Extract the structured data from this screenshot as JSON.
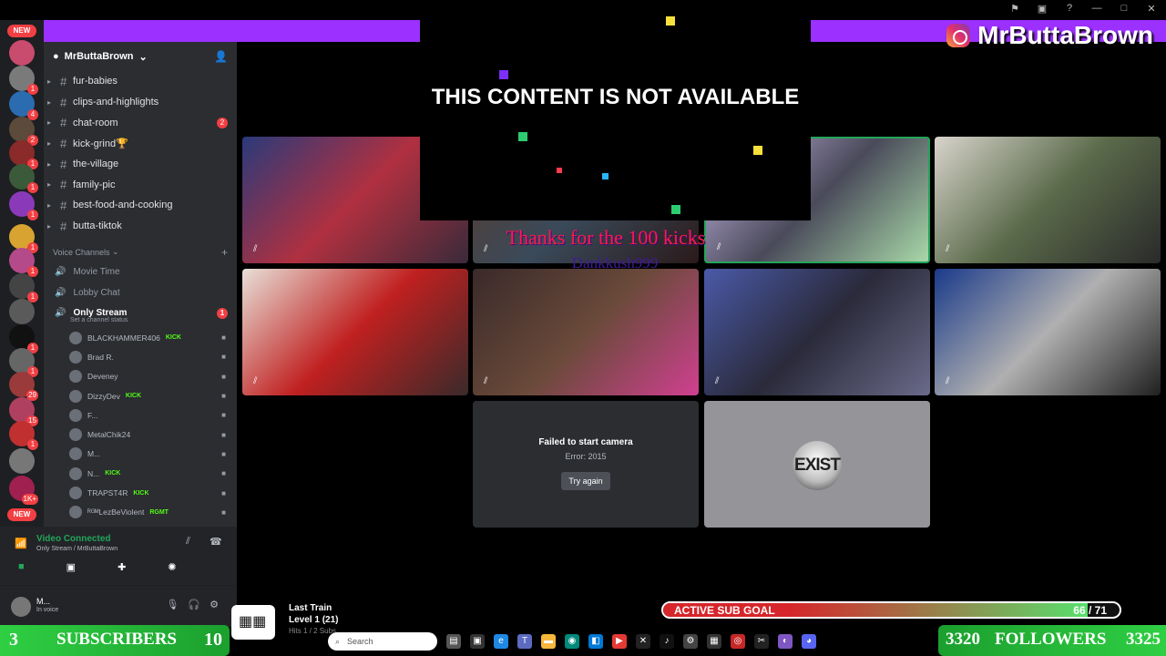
{
  "brand": {
    "name": "MrButtaBrown"
  },
  "window_controls": [
    "⚑",
    "▣",
    "?",
    "—",
    "□",
    "✕"
  ],
  "servers": [
    {
      "top": 0,
      "color": "#c94b6e",
      "badge": ""
    },
    {
      "top": 0,
      "color": "#7a7a7a",
      "badge": "1"
    },
    {
      "top": 0,
      "color": "#2b6cb0",
      "badge": "4"
    },
    {
      "top": 0,
      "color": "#5c4a3a",
      "badge": "2"
    },
    {
      "top": 0,
      "color": "#8b2a2a",
      "badge": "1"
    },
    {
      "top": 0,
      "color": "#3a5a3a",
      "badge": "1"
    },
    {
      "top": 0,
      "color": "#8a3ab9",
      "badge": "1"
    },
    {
      "top": 0,
      "color": "#d9a331",
      "badge": "1"
    },
    {
      "top": 0,
      "color": "#b54a8a",
      "badge": "1"
    },
    {
      "top": 0,
      "color": "#444",
      "badge": "1"
    },
    {
      "top": 0,
      "color": "#5a5a5a",
      "badge": ""
    },
    {
      "top": 0,
      "color": "#111",
      "badge": "1"
    },
    {
      "top": 0,
      "color": "#666",
      "badge": "1"
    },
    {
      "top": 0,
      "color": "#9a3a3a",
      "badge": "29"
    },
    {
      "top": 0,
      "color": "#b04060",
      "badge": "15"
    },
    {
      "top": 0,
      "color": "#c03030",
      "badge": "1"
    },
    {
      "top": 0,
      "color": "#777",
      "badge": ""
    },
    {
      "top": 0,
      "color": "#a02050",
      "badge": "1K+"
    }
  ],
  "new_labels": [
    "NEW",
    "NEW"
  ],
  "guild": {
    "name": "MrButtaBrown"
  },
  "text_channels": [
    {
      "name": "fur-babies",
      "badge": ""
    },
    {
      "name": "clips-and-highlights",
      "badge": ""
    },
    {
      "name": "chat-room",
      "badge": "2"
    },
    {
      "name": "kick-grind🏆",
      "badge": ""
    },
    {
      "name": "the-village",
      "badge": ""
    },
    {
      "name": "family-pic",
      "badge": ""
    },
    {
      "name": "best-food-and-cooking",
      "badge": ""
    },
    {
      "name": "butta-tiktok",
      "badge": ""
    }
  ],
  "voice_section": "Voice Channels",
  "voice_channels": [
    {
      "name": "Movie Time",
      "badge": ""
    },
    {
      "name": "Lobby Chat",
      "badge": ""
    },
    {
      "name": "Only Stream",
      "badge": "1"
    }
  ],
  "channel_status": "Set a channel status",
  "voice_users": [
    {
      "name": "BLACKHAMMER406",
      "kick": "KICK"
    },
    {
      "name": "Brad R.",
      "kick": ""
    },
    {
      "name": "Deveney",
      "kick": ""
    },
    {
      "name": "DizzyDev",
      "kick": "KICK"
    },
    {
      "name": "F...",
      "kick": ""
    },
    {
      "name": "MetalChik24",
      "kick": ""
    },
    {
      "name": "M...",
      "kick": ""
    },
    {
      "name": "N...",
      "kick": "KICK"
    },
    {
      "name": "TRAPST4R",
      "kick": "KICK"
    },
    {
      "name": "ᴿᴳᴹLezBeViolent",
      "kick": "RGMT"
    }
  ],
  "voice_status": {
    "title": "Video Connected",
    "sub": "Only Stream / MrButtaBrown"
  },
  "user_panel": {
    "name": "M...",
    "status": "In voice"
  },
  "stage": {
    "unavailable": "THIS CONTENT IS NOT AVAILABLE",
    "kicks_msg": "Thanks for the 100 kicks",
    "kicks_user": "Dankkush999",
    "cam_error_title": "Failed to start camera",
    "cam_error_code": "Error: 2015",
    "try_again": "Try again",
    "exist_logo": "EXIST"
  },
  "tiles": [
    {
      "bg": "linear-gradient(135deg,#2a3a7a,#b03040 50%,#3a2a3a)"
    },
    {
      "bg": "linear-gradient(135deg,#5a3a2a,#3a4a5a 50%,#2a1a1a)"
    },
    {
      "bg": "linear-gradient(135deg,#c8b8e8,#4a4a5a 50%,#a8d8a8)"
    },
    {
      "bg": "linear-gradient(135deg,#d8d4cc,#5a6a4a 50%,#2a2a2a)"
    },
    {
      "bg": "linear-gradient(135deg,#e8e0d8,#c02020 50%,#3a2a2a)"
    },
    {
      "bg": "linear-gradient(135deg,#3a2a2a,#6a4a3a 50%,#d04090)"
    },
    {
      "bg": "linear-gradient(135deg,#4a5aa8,#2a2a3a 50%,#6a6a8a)"
    },
    {
      "bg": "linear-gradient(135deg,#1a3a8a,#b0b0b0 50%,#202020)"
    }
  ],
  "sub_goal": {
    "label": "ACTIVE SUB GOAL",
    "current": 66,
    "target": 71,
    "count_text": "66 / 71"
  },
  "subscribers": {
    "left": "3",
    "label": "SUBSCRIBERS",
    "right": "10"
  },
  "followers": {
    "left": "3320",
    "label": "FOLLOWERS",
    "right": "3325"
  },
  "music": {
    "title": "Last Train",
    "level": "Level 1 (21)",
    "extra": "Hits 1 / 2 Subs"
  },
  "taskbar": {
    "search": "Search"
  }
}
